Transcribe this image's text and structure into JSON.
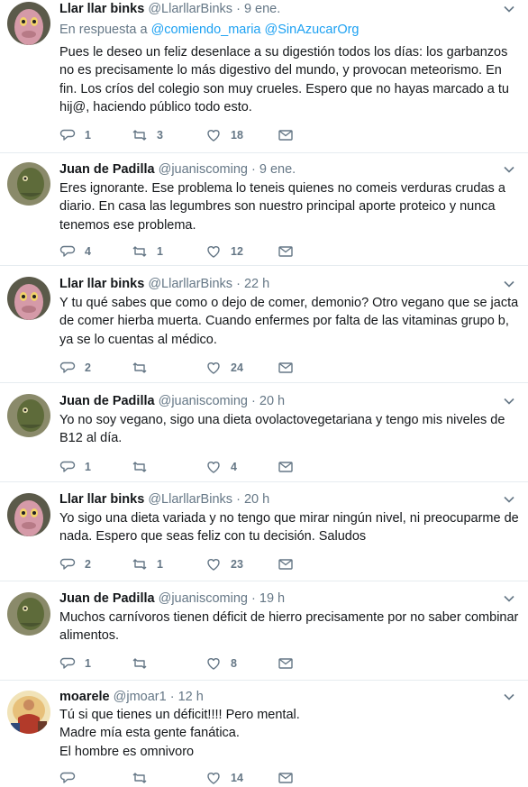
{
  "tweets": [
    {
      "name": "Llar llar binks",
      "handle": "@LlarllarBinks",
      "time": "9 ene.",
      "avatar_icon": "pink-alien-avatar-icon",
      "reply_prefix": "En respuesta a",
      "reply_mentions": "@comiendo_maria @SinAzucarOrg",
      "text": "Pues le deseo un feliz desenlace a su digestión todos los días: los garbanzos no es precisamente lo más digestivo del mundo, y provocan meteorismo. En fin. Los críos del colegio son muy crueles. Espero que no hayas marcado a tu hij@, haciendo público todo esto.",
      "replies": "1",
      "retweets": "3",
      "likes": "18"
    },
    {
      "name": "Juan de Padilla",
      "handle": "@juaniscoming",
      "time": "9 ene.",
      "avatar_icon": "green-creature-avatar-icon",
      "text": "Eres ignorante. Ese problema lo teneis quienes no comeis verduras crudas a diario. En casa las legumbres son nuestro principal aporte proteico y nunca tenemos ese problema.",
      "replies": "4",
      "retweets": "1",
      "likes": "12"
    },
    {
      "name": "Llar llar binks",
      "handle": "@LlarllarBinks",
      "time": "22 h",
      "avatar_icon": "pink-alien-avatar-icon",
      "text": "Y tu qué sabes que como o dejo de comer, demonio? Otro vegano que se jacta de comer hierba muerta. Cuando enfermes por falta de las vitaminas grupo b, ya se lo cuentas al médico.",
      "replies": "2",
      "retweets": "",
      "likes": "24"
    },
    {
      "name": "Juan de Padilla",
      "handle": "@juaniscoming",
      "time": "20 h",
      "avatar_icon": "green-creature-avatar-icon",
      "text": "Yo no soy vegano, sigo una dieta ovolactovegetariana y tengo mis niveles de B12 al día.",
      "replies": "1",
      "retweets": "",
      "likes": "4"
    },
    {
      "name": "Llar llar binks",
      "handle": "@LlarllarBinks",
      "time": "20 h",
      "avatar_icon": "pink-alien-avatar-icon",
      "text": "Yo sigo una dieta variada y no tengo que mirar ningún nivel, ni preocuparme de nada. Espero que seas feliz con tu decisión. Saludos",
      "replies": "2",
      "retweets": "1",
      "likes": "23"
    },
    {
      "name": "Juan de Padilla",
      "handle": "@juaniscoming",
      "time": "19 h",
      "avatar_icon": "green-creature-avatar-icon",
      "text": "Muchos carnívoros tienen déficit de hierro precisamente por no saber combinar alimentos.",
      "replies": "1",
      "retweets": "",
      "likes": "8"
    },
    {
      "name": "moarele",
      "handle": "@jmoar1",
      "time": "12 h",
      "avatar_icon": "painting-avatar-icon",
      "lines": [
        "Tú si que tienes un déficit!!!! Pero mental.",
        "Madre mía esta gente fanática.",
        "El hombre es omnivoro"
      ],
      "replies": "",
      "retweets": "",
      "likes": "14"
    }
  ],
  "separator": "·",
  "colors": {
    "mention": "#1da1f2",
    "secondary": "#657786",
    "text": "#14171a"
  }
}
